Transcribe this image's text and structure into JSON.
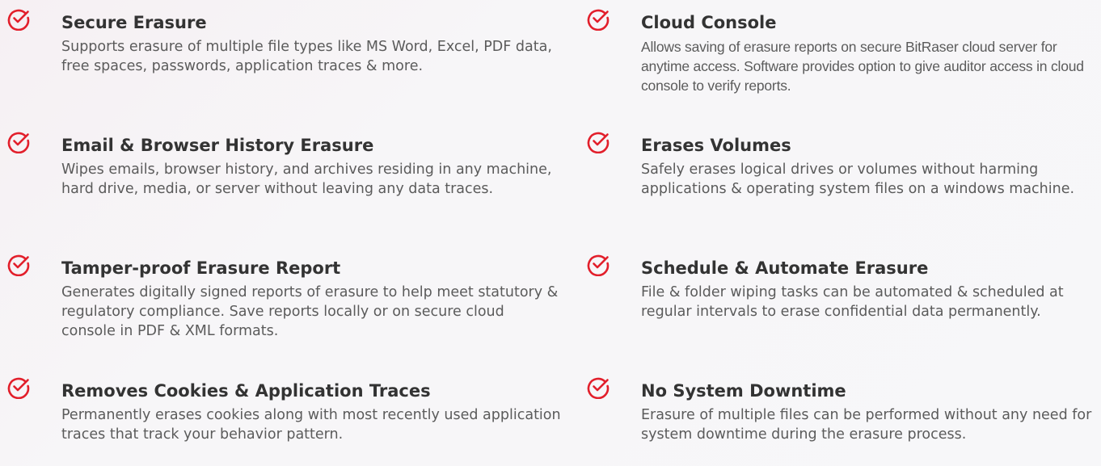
{
  "accent_color": "#e21f2b",
  "features_left": [
    {
      "icon": "check-circle-icon",
      "title": "Secure Erasure",
      "description": "Supports erasure of multiple file types like MS Word, Excel, PDF data, free spaces, passwords, application traces & more."
    },
    {
      "icon": "check-circle-icon",
      "title": "Email & Browser History Erasure",
      "description": "Wipes emails, browser history, and archives residing in any machine, hard drive, media, or server without leaving any data traces."
    },
    {
      "icon": "check-circle-icon",
      "title": "Tamper-proof Erasure Report",
      "description": "Generates digitally signed reports of erasure to help meet statutory & regulatory compliance. Save reports locally or on secure cloud console in PDF & XML formats."
    },
    {
      "icon": "check-circle-icon",
      "title": "Removes Cookies & Application Traces",
      "description": "Permanently erases cookies along with most recently used application traces that track your behavior pattern."
    }
  ],
  "features_right": [
    {
      "icon": "check-circle-icon",
      "title": "Cloud Console",
      "description": "Allows saving of erasure reports on secure BitRaser cloud server for anytime access. Software provides option to give auditor access in cloud console to verify reports."
    },
    {
      "icon": "check-circle-icon",
      "title": "Erases Volumes",
      "description": "Safely erases logical drives or volumes without harming applications & operating system files on a windows machine."
    },
    {
      "icon": "check-circle-icon",
      "title": "Schedule & Automate Erasure",
      "description": "File & folder wiping tasks can be automated & scheduled at regular intervals to erase confidential data permanently."
    },
    {
      "icon": "check-circle-icon",
      "title": "No System Downtime",
      "description": "Erasure of multiple files can be performed without any need for system downtime during the erasure process."
    }
  ]
}
